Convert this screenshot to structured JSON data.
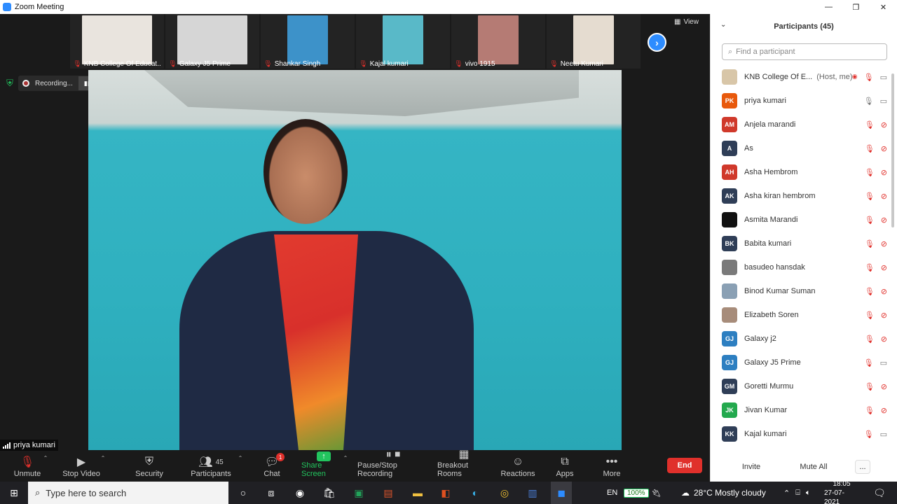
{
  "window": {
    "title": "Zoom Meeting",
    "controls": [
      "—",
      "❐",
      "✕"
    ]
  },
  "thumbnails": [
    {
      "name": "KNB College Of Educat...",
      "bg": "#e9e4de"
    },
    {
      "name": "Galaxy J5 Prime",
      "bg": "#d6d6d6"
    },
    {
      "name": "Shankar Singh",
      "bg": "#3d92c9"
    },
    {
      "name": "Kajal kumari",
      "bg": "#59b9c8"
    },
    {
      "name": "vivo 1915",
      "bg": "#b57b74"
    },
    {
      "name": "Neetu Kumari",
      "bg": "#e5dcd0"
    }
  ],
  "view_label": "View",
  "recording": {
    "label": "Recording...",
    "pause": "▮▮",
    "stop": "■"
  },
  "active_speaker": "priya kumari",
  "toolbar": {
    "unmute": "Unmute",
    "stop_video": "Stop Video",
    "security": "Security",
    "participants": "Participants",
    "participants_count": "45",
    "chat": "Chat",
    "chat_badge": "1",
    "share_screen": "Share Screen",
    "recording": "Pause/Stop Recording",
    "breakout": "Breakout Rooms",
    "reactions": "Reactions",
    "apps": "Apps",
    "more": "More",
    "end": "End"
  },
  "panel": {
    "title": "Participants (45)",
    "search_placeholder": "Find a participant",
    "invite": "Invite",
    "mute_all": "Mute All",
    "more": "..."
  },
  "participants": [
    {
      "initials": "",
      "name": "KNB College Of E...",
      "host": "(Host, me)",
      "color": "#d8c6a8",
      "mic": "off",
      "cam": "on",
      "rec": true
    },
    {
      "initials": "PK",
      "name": "priya kumari",
      "host": "",
      "color": "#e8590c",
      "mic": "on",
      "cam": "on",
      "rec": false
    },
    {
      "initials": "AM",
      "name": "Anjela marandi",
      "host": "",
      "color": "#d0392b",
      "mic": "off",
      "cam": "off",
      "rec": false
    },
    {
      "initials": "A",
      "name": "As",
      "host": "",
      "color": "#2f3e57",
      "mic": "off",
      "cam": "off",
      "rec": false
    },
    {
      "initials": "AH",
      "name": "Asha Hembrom",
      "host": "",
      "color": "#d0392b",
      "mic": "off",
      "cam": "off",
      "rec": false
    },
    {
      "initials": "AK",
      "name": "Asha kiran hembrom",
      "host": "",
      "color": "#2f3e57",
      "mic": "off",
      "cam": "off",
      "rec": false
    },
    {
      "initials": "",
      "name": "Asmita Marandi",
      "host": "",
      "color": "#111111",
      "mic": "off",
      "cam": "off",
      "rec": false
    },
    {
      "initials": "BK",
      "name": "Babita kumari",
      "host": "",
      "color": "#2f3e57",
      "mic": "off",
      "cam": "off",
      "rec": false
    },
    {
      "initials": "",
      "name": "basudeo hansdak",
      "host": "",
      "color": "#7a7a7a",
      "mic": "off",
      "cam": "off",
      "rec": false
    },
    {
      "initials": "",
      "name": "Binod Kumar Suman",
      "host": "",
      "color": "#8aa0b4",
      "mic": "off",
      "cam": "off",
      "rec": false
    },
    {
      "initials": "",
      "name": "Elizabeth Soren",
      "host": "",
      "color": "#a78c7a",
      "mic": "off",
      "cam": "off",
      "rec": false
    },
    {
      "initials": "GJ",
      "name": "Galaxy j2",
      "host": "",
      "color": "#2d7fc1",
      "mic": "off",
      "cam": "off",
      "rec": false
    },
    {
      "initials": "GJ",
      "name": "Galaxy J5 Prime",
      "host": "",
      "color": "#2d7fc1",
      "mic": "off",
      "cam": "on",
      "rec": false
    },
    {
      "initials": "GM",
      "name": "Goretti Murmu",
      "host": "",
      "color": "#2f3e57",
      "mic": "off",
      "cam": "off",
      "rec": false
    },
    {
      "initials": "JK",
      "name": "Jivan Kumar",
      "host": "",
      "color": "#23a94e",
      "mic": "off",
      "cam": "off",
      "rec": false
    },
    {
      "initials": "KK",
      "name": "Kajal kumari",
      "host": "",
      "color": "#2f3e57",
      "mic": "off",
      "cam": "on",
      "rec": false
    }
  ],
  "taskbar": {
    "search_placeholder": "Type here to search",
    "lang": "EN",
    "battery": "100%",
    "weather": "28°C  Mostly cloudy",
    "time": "18:05",
    "date": "27-07-2021"
  }
}
